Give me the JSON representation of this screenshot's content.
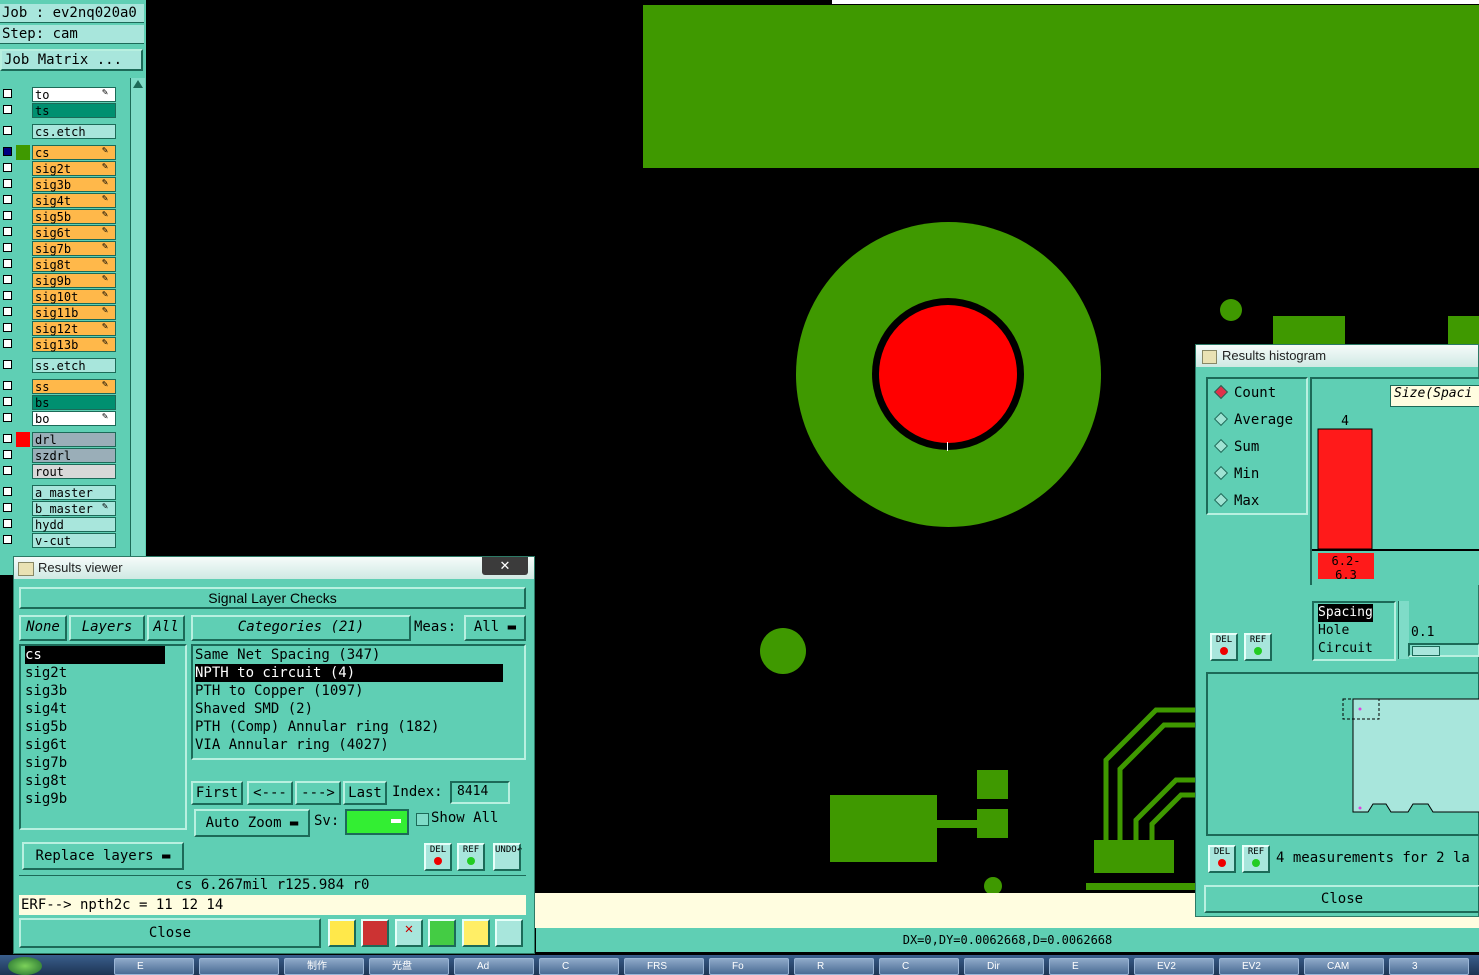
{
  "left_panel": {
    "job_label": "Job : ev2nq020a0",
    "step_label": "Step: cam",
    "job_matrix_button": "Job Matrix ...",
    "layers": [
      {
        "name": "to",
        "color": "#ffffff",
        "row_color": "#ffffff",
        "edit": true
      },
      {
        "name": "ts",
        "color": "#009070",
        "row_color": "#009070",
        "edit": false
      },
      {
        "name": "cs.etch",
        "color": "#a8e6dc",
        "row_color": "#a8e6dc",
        "edit": false
      },
      {
        "name": "cs",
        "color": "#ffb84a",
        "row_color": "#ffb84a",
        "edit": true,
        "active": true
      },
      {
        "name": "sig2t",
        "color": "#ffb84a",
        "row_color": "#ffb84a",
        "edit": true
      },
      {
        "name": "sig3b",
        "color": "#ffb84a",
        "row_color": "#ffb84a",
        "edit": true
      },
      {
        "name": "sig4t",
        "color": "#ffb84a",
        "row_color": "#ffb84a",
        "edit": true
      },
      {
        "name": "sig5b",
        "color": "#ffb84a",
        "row_color": "#ffb84a",
        "edit": true
      },
      {
        "name": "sig6t",
        "color": "#ffb84a",
        "row_color": "#ffb84a",
        "edit": true
      },
      {
        "name": "sig7b",
        "color": "#ffb84a",
        "row_color": "#ffb84a",
        "edit": true
      },
      {
        "name": "sig8t",
        "color": "#ffb84a",
        "row_color": "#ffb84a",
        "edit": true
      },
      {
        "name": "sig9b",
        "color": "#ffb84a",
        "row_color": "#ffb84a",
        "edit": true
      },
      {
        "name": "sig10t",
        "color": "#ffb84a",
        "row_color": "#ffb84a",
        "edit": true
      },
      {
        "name": "sig11b",
        "color": "#ffb84a",
        "row_color": "#ffb84a",
        "edit": true
      },
      {
        "name": "sig12t",
        "color": "#ffb84a",
        "row_color": "#ffb84a",
        "edit": true
      },
      {
        "name": "sig13b",
        "color": "#ffb84a",
        "row_color": "#ffb84a",
        "edit": true
      },
      {
        "name": "ss.etch",
        "color": "#a8e6dc",
        "row_color": "#a8e6dc",
        "edit": false
      },
      {
        "name": "ss",
        "color": "#ffb84a",
        "row_color": "#ffb84a",
        "edit": true
      },
      {
        "name": "bs",
        "color": "#009070",
        "row_color": "#009070",
        "edit": false
      },
      {
        "name": "bo",
        "color": "#ffffff",
        "row_color": "#ffffff",
        "edit": true
      },
      {
        "name": "drl",
        "color": "#9aaeb8",
        "row_color": "#9aaeb8",
        "edit": false,
        "swatch": "#ff0000"
      },
      {
        "name": "szdrl",
        "color": "#9aaeb8",
        "row_color": "#9aaeb8",
        "edit": false
      },
      {
        "name": "rout",
        "color": "#d8d8d8",
        "row_color": "#d8d8d8",
        "edit": false
      },
      {
        "name": "a_master",
        "color": "#a8e6dc",
        "row_color": "#a8e6dc",
        "edit": false
      },
      {
        "name": "b_master",
        "color": "#a8e6dc",
        "row_color": "#a8e6dc",
        "edit": true
      },
      {
        "name": "hydd",
        "color": "#a8e6dc",
        "row_color": "#a8e6dc",
        "edit": false
      },
      {
        "name": "v-cut",
        "color": "#a8e6dc",
        "row_color": "#a8e6dc",
        "edit": false
      }
    ]
  },
  "results_viewer": {
    "window_title": "Results viewer",
    "header": "Signal Layer Checks",
    "layer_buttons": {
      "none": "None",
      "layers": "Layers",
      "all": "All"
    },
    "layers_list": [
      "cs",
      "sig2t",
      "sig3b",
      "sig4t",
      "sig5b",
      "sig6t",
      "sig7b",
      "sig8t",
      "sig9b"
    ],
    "categories_button": "Categories (21)",
    "meas_label": "Meas:",
    "meas_value": "All",
    "categories": [
      "Same Net Spacing (347)",
      "NPTH to circuit (4)",
      "PTH to Copper (1097)",
      "Shaved SMD (2)",
      "PTH (Comp) Annular ring (182)",
      "VIA Annular ring (4027)"
    ],
    "selected_category_index": 1,
    "nav": {
      "first": "First",
      "prev": "<---",
      "next": "--->",
      "last": "Last",
      "index_label": "Index:",
      "index_value": "8414"
    },
    "auto_zoom": "Auto Zoom",
    "sv_label": "Sv:",
    "show_all": "Show All",
    "replace_layers": "Replace layers",
    "icon_buttons": {
      "del": "DEL",
      "ref": "REF",
      "undo": "UNDO"
    },
    "status_line": "cs 6.267mil   r125.984  r0",
    "erf_line": "ERF--> npth2c = 11 12 14",
    "close": "Close"
  },
  "histogram": {
    "window_title": "Results histogram",
    "modes": [
      "Count",
      "Average",
      "Sum",
      "Min",
      "Max"
    ],
    "selected_mode": "Count",
    "title_box": "Size(Spaci",
    "chart_data": {
      "type": "bar",
      "categories": [
        "6.2-6.3"
      ],
      "values": [
        4
      ]
    },
    "category_label_lines": [
      "6.2-",
      "6.3"
    ],
    "filter_list": [
      "Spacing",
      "Hole",
      "Circuit"
    ],
    "slider_value": "0.1",
    "summary": "4 measurements for 2 la",
    "close": "Close",
    "icon_buttons": {
      "del": "DEL",
      "ref": "REF"
    }
  },
  "status_bar": {
    "coords": "DX=0,DY=0.0062668,D=0.0062668"
  },
  "taskbar": {
    "items": [
      "E",
      "",
      "制作",
      "光盘",
      "Ad",
      "C",
      "FRS",
      "Fo",
      "R",
      "C",
      "Dir",
      "E",
      "EV2",
      "EV2",
      "CAM",
      "3"
    ]
  }
}
